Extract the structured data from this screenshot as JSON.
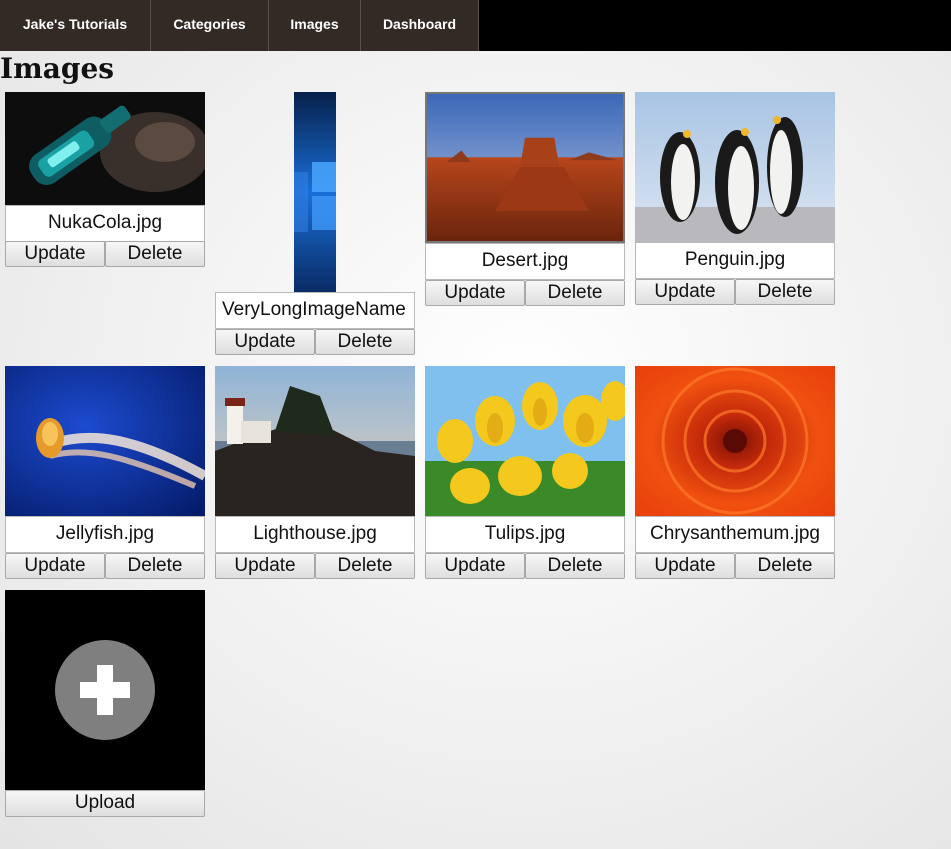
{
  "nav": {
    "items": [
      "Jake's Tutorials",
      "Categories",
      "Images",
      "Dashboard"
    ]
  },
  "page": {
    "title": "Images"
  },
  "buttons": {
    "update": "Update",
    "delete": "Delete",
    "upload": "Upload"
  },
  "images": [
    {
      "filename": "NukaCola.jpg",
      "icon": "nuka-cola-bottle-image"
    },
    {
      "filename": "VeryLongImageName",
      "icon": "windows-wallpaper-image"
    },
    {
      "filename": "Desert.jpg",
      "icon": "desert-image"
    },
    {
      "filename": "Penguin.jpg",
      "icon": "penguins-image"
    },
    {
      "filename": "Jellyfish.jpg",
      "icon": "jellyfish-image"
    },
    {
      "filename": "Lighthouse.jpg",
      "icon": "lighthouse-image"
    },
    {
      "filename": "Tulips.jpg",
      "icon": "tulips-image"
    },
    {
      "filename": "Chrysanthemum.jpg",
      "icon": "chrysanthemum-image"
    }
  ],
  "upload": {
    "icon": "plus-icon"
  }
}
